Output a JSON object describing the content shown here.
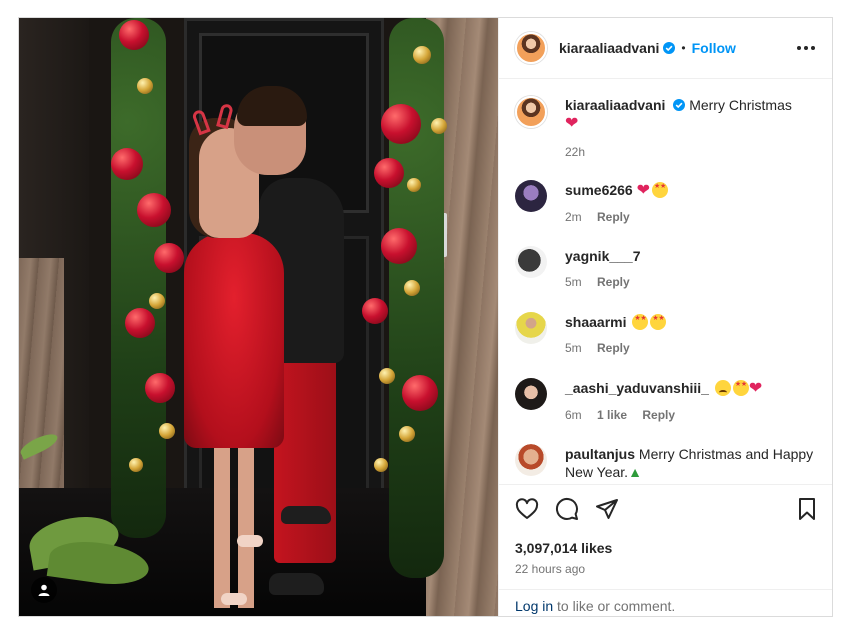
{
  "post": {
    "author": {
      "username": "kiaraaliaadvani",
      "verified": true,
      "follow_label": "Follow",
      "separator": "•"
    },
    "caption": {
      "username": "kiaraaliaadvani",
      "text": "Merry Christmas",
      "emoji": "❤",
      "time": "22h"
    },
    "comments": [
      {
        "username": "sume6266",
        "text": "",
        "emojis": [
          "heart-red",
          "star-struck"
        ],
        "time": "2m",
        "likes": "",
        "reply_label": "Reply"
      },
      {
        "username": "yagnik___7",
        "text": "",
        "emojis": [],
        "time": "5m",
        "likes": "",
        "reply_label": "Reply"
      },
      {
        "username": "shaaarmi",
        "text": "",
        "emojis": [
          "star-struck",
          "star-struck"
        ],
        "time": "5m",
        "likes": "",
        "reply_label": "Reply"
      },
      {
        "username": "_aashi_yaduvanshiii_",
        "text": "",
        "emojis": [
          "sad-face",
          "star-struck",
          "heart-red"
        ],
        "time": "6m",
        "likes": "1 like",
        "reply_label": "Reply"
      },
      {
        "username": "paultanjus",
        "text": "Merry Christmas and Happy New Year.",
        "emojis": [
          "christmas-tree"
        ],
        "time": "",
        "likes": "",
        "reply_label": ""
      }
    ],
    "likes": "3,097,014 likes",
    "posted_ago": "22 hours ago",
    "login_prompt": {
      "link": "Log in",
      "rest": " to like or comment."
    },
    "colors": {
      "accent": "#0095f6",
      "text": "#262626",
      "muted": "#737373",
      "border": "#dbdbdb",
      "link": "#00376b"
    },
    "icons": [
      "more-options-icon",
      "verified-badge-icon",
      "like-icon",
      "comment-icon",
      "share-icon",
      "save-icon",
      "user-tag-icon"
    ]
  }
}
